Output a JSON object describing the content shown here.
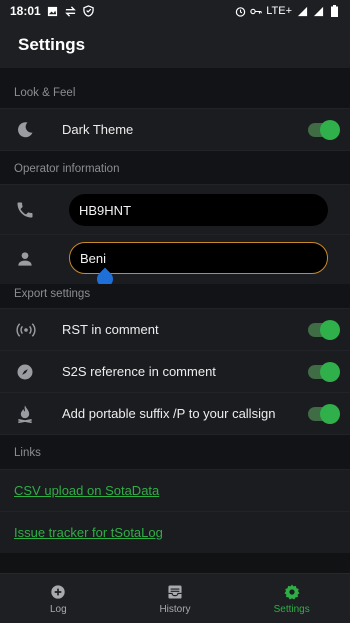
{
  "status_bar": {
    "time": "18:01",
    "network": "LTE+",
    "icons": [
      "image-icon",
      "data-transfer-icon",
      "vpn-shield-icon",
      "alarm-icon",
      "key-icon",
      "signal-icon",
      "signal-icon",
      "battery-icon"
    ]
  },
  "app_bar": {
    "title": "Settings"
  },
  "sections": {
    "look_feel": {
      "label": "Look & Feel"
    },
    "operator": {
      "label": "Operator information"
    },
    "export": {
      "label": "Export settings"
    },
    "links": {
      "label": "Links"
    }
  },
  "dark_theme": {
    "label": "Dark Theme",
    "enabled": true,
    "icon": "moon-icon"
  },
  "callsign_field": {
    "value": "HB9HNT",
    "icon": "phone-icon"
  },
  "name_field": {
    "value": "Beni",
    "icon": "person-icon"
  },
  "rst_comment": {
    "label": "RST in comment",
    "enabled": true,
    "icon": "radio-waves-icon"
  },
  "s2s_comment": {
    "label": "S2S reference in comment",
    "enabled": true,
    "icon": "compass-icon"
  },
  "portable_suffix": {
    "label": "Add portable suffix /P to your callsign",
    "enabled": true,
    "icon": "campfire-icon"
  },
  "links": {
    "csv_upload": "CSV upload on SotaData",
    "issue_tracker": "Issue tracker for tSotaLog"
  },
  "bottom_nav": {
    "log": "Log",
    "history": "History",
    "settings": "Settings",
    "active": "settings"
  },
  "colors": {
    "accent": "#2fae46",
    "focus_border": "#c98a2a",
    "background": "#111214"
  }
}
